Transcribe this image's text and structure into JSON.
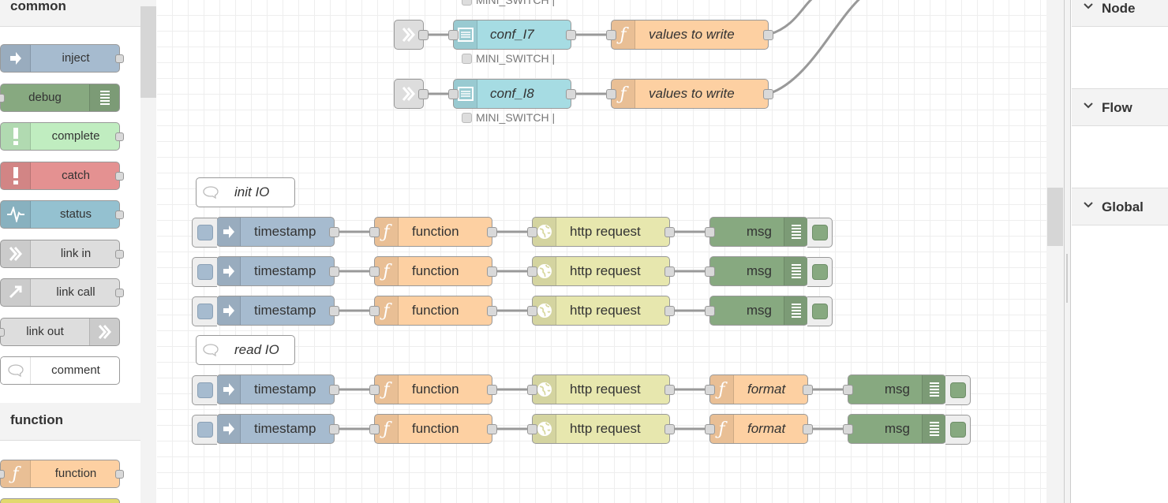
{
  "palette": {
    "categories": [
      {
        "label": "common"
      },
      {
        "label": "function"
      }
    ],
    "nodes": [
      {
        "label": "inject",
        "color": "#a6bbcf",
        "icon": "arrow-in-icon"
      },
      {
        "label": "debug",
        "color": "#87a980",
        "icon": "list-icon"
      },
      {
        "label": "complete",
        "color": "#c0edc0",
        "icon": "exclamation-icon"
      },
      {
        "label": "catch",
        "color": "#e49191",
        "icon": "exclamation-icon"
      },
      {
        "label": "status",
        "color": "#94c1d0",
        "icon": "pulse-icon"
      },
      {
        "label": "link in",
        "color": "#dddddd",
        "icon": "link-in-icon"
      },
      {
        "label": "link call",
        "color": "#dddddd",
        "icon": "link-call-icon"
      },
      {
        "label": "link out",
        "color": "#dddddd",
        "icon": "link-out-icon"
      },
      {
        "label": "comment",
        "color": "#ffffff",
        "icon": "speech-bubble-icon"
      },
      {
        "label": "function",
        "color": "#fdd0a2",
        "icon": "function-icon"
      }
    ]
  },
  "flow": {
    "conf_nodes": [
      {
        "config": "conf_I7",
        "write": "values to write",
        "status": "MINI_SWITCH |"
      },
      {
        "config": "conf_I8",
        "write": "values to write",
        "status": "MINI_SWITCH |"
      }
    ],
    "top_status": "MINI_SWITCH |",
    "comments": [
      {
        "label": "init IO"
      },
      {
        "label": "read IO"
      }
    ],
    "rows": [
      {
        "inject": "timestamp",
        "function": "function",
        "http": "http request",
        "debug": "msg"
      },
      {
        "inject": "timestamp",
        "function": "function",
        "http": "http request",
        "debug": "msg"
      },
      {
        "inject": "timestamp",
        "function": "function",
        "http": "http request",
        "debug": "msg"
      },
      {
        "inject": "timestamp",
        "function": "function",
        "http": "http request",
        "format": "format",
        "debug": "msg"
      },
      {
        "inject": "timestamp",
        "function": "function",
        "http": "http request",
        "format": "format",
        "debug": "msg"
      }
    ],
    "colors": {
      "inject": "#a6bbcf",
      "function": "#fdd0a2",
      "http": "#e7e7ae",
      "debug": "#87a980",
      "config": "#a6dce3",
      "link": "#dddddd"
    }
  },
  "sidebar": {
    "sections": [
      {
        "label": "Node"
      },
      {
        "label": "Flow"
      },
      {
        "label": "Global"
      }
    ]
  }
}
